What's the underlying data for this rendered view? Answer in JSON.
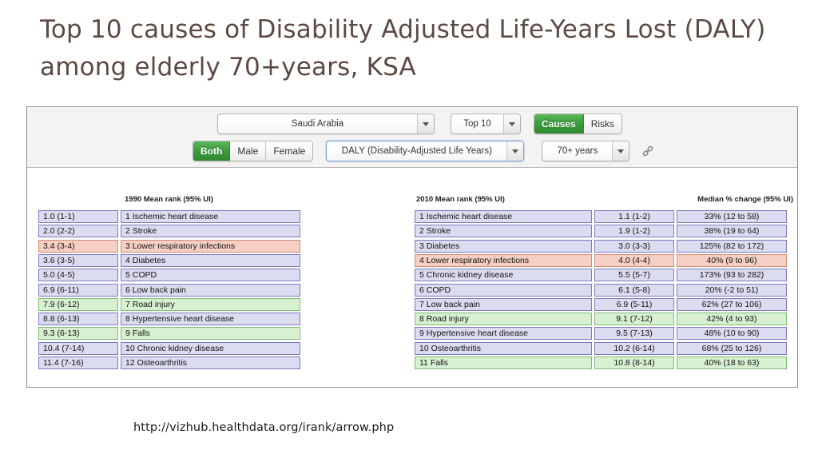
{
  "slide": {
    "title": "Top 10 causes of Disability Adjusted Life-Years Lost (DALY)\namong elderly 70+years, KSA",
    "caption": "http://vizhub.healthdata.org/irank/arrow.php"
  },
  "toolbar": {
    "country": "Saudi Arabia",
    "top_n": "Top 10",
    "causes_label": "Causes",
    "risks_label": "Risks",
    "sex_both": "Both",
    "sex_male": "Male",
    "sex_female": "Female",
    "metric": "DALY (Disability-Adjusted Life Years)",
    "age": "70+ years",
    "link_icon": "chain-link-icon"
  },
  "colors": {
    "accent_green": "#3d9d3d",
    "cell_default": "#dcdcf0",
    "cell_default_border": "#7a79c0",
    "cell_pink": "#f6cfc4",
    "cell_pink_border": "#d08a72",
    "cell_green": "#d7f0d2",
    "cell_green_border": "#7cbb74",
    "connector_navy": "#2a2a7a",
    "connector_red": "#c0392b",
    "connector_green": "#2e7d32",
    "title_brown": "#5c4a41"
  },
  "chart_data": {
    "type": "table",
    "title": "Top 10 causes of Disability Adjusted Life-Years Lost (DALY) among elderly 70+years, KSA",
    "headers": {
      "left": "1990 Mean rank (95% UI)",
      "right": "2010 Mean rank (95% UI)",
      "change": "Median % change (95% UI)"
    },
    "left_column": [
      {
        "rank": "1.0 (1-1)",
        "name": "1 Ischemic heart disease",
        "color": "default"
      },
      {
        "rank": "2.0 (2-2)",
        "name": "2 Stroke",
        "color": "default"
      },
      {
        "rank": "3.4 (3-4)",
        "name": "3 Lower respiratory infections",
        "color": "pink"
      },
      {
        "rank": "3.6 (3-5)",
        "name": "4 Diabetes",
        "color": "default"
      },
      {
        "rank": "5.0 (4-5)",
        "name": "5 COPD",
        "color": "default"
      },
      {
        "rank": "6.9 (6-11)",
        "name": "6 Low back pain",
        "color": "default"
      },
      {
        "rank": "7.9 (6-12)",
        "name": "7 Road injury",
        "color": "green"
      },
      {
        "rank": "8.8 (6-13)",
        "name": "8 Hypertensive heart disease",
        "color": "default"
      },
      {
        "rank": "9.3 (6-13)",
        "name": "9 Falls",
        "color": "green"
      },
      {
        "rank": "10.4 (7-14)",
        "name": "10 Chronic kidney disease",
        "color": "default"
      },
      {
        "rank": "11.4 (7-16)",
        "name": "12 Osteoarthritis",
        "color": "default"
      }
    ],
    "right_column": [
      {
        "name": "1 Ischemic heart disease",
        "rank": "1.1 (1-2)",
        "change": "33% (12 to 58)",
        "color": "default"
      },
      {
        "name": "2 Stroke",
        "rank": "1.9 (1-2)",
        "change": "38% (19 to 64)",
        "color": "default"
      },
      {
        "name": "3 Diabetes",
        "rank": "3.0 (3-3)",
        "change": "125% (82 to 172)",
        "color": "default"
      },
      {
        "name": "4 Lower respiratory infections",
        "rank": "4.0 (4-4)",
        "change": "40% (9 to 96)",
        "color": "pink"
      },
      {
        "name": "5 Chronic kidney disease",
        "rank": "5.5 (5-7)",
        "change": "173% (93 to 282)",
        "color": "default"
      },
      {
        "name": "6 COPD",
        "rank": "6.1 (5-8)",
        "change": "20% (-2 to 51)",
        "color": "default"
      },
      {
        "name": "7 Low back pain",
        "rank": "6.9 (5-11)",
        "change": "62% (27 to 106)",
        "color": "default"
      },
      {
        "name": "8 Road injury",
        "rank": "9.1 (7-12)",
        "change": "42% (4 to 93)",
        "color": "green"
      },
      {
        "name": "9 Hypertensive heart disease",
        "rank": "9.5 (7-13)",
        "change": "48% (10 to 90)",
        "color": "default"
      },
      {
        "name": "10 Osteoarthritis",
        "rank": "10.2 (6-14)",
        "change": "68% (25 to 126)",
        "color": "default"
      },
      {
        "name": "11 Falls",
        "rank": "10.8 (8-14)",
        "change": "40% (18 to 63)",
        "color": "green"
      }
    ],
    "connectors": [
      {
        "from": 0,
        "to": 0,
        "style": "solid",
        "color": "navy"
      },
      {
        "from": 1,
        "to": 1,
        "style": "solid",
        "color": "navy"
      },
      {
        "from": 2,
        "to": 3,
        "style": "dashed",
        "color": "red"
      },
      {
        "from": 3,
        "to": 2,
        "style": "solid",
        "color": "navy"
      },
      {
        "from": 4,
        "to": 5,
        "style": "dashed",
        "color": "navy"
      },
      {
        "from": 5,
        "to": 6,
        "style": "dashed",
        "color": "navy"
      },
      {
        "from": 6,
        "to": 7,
        "style": "dashed",
        "color": "green"
      },
      {
        "from": 7,
        "to": 8,
        "style": "dashed",
        "color": "navy"
      },
      {
        "from": 8,
        "to": 10,
        "style": "dashed",
        "color": "green"
      },
      {
        "from": 9,
        "to": 4,
        "style": "solid",
        "color": "navy"
      },
      {
        "from": 10,
        "to": 9,
        "style": "solid",
        "color": "navy"
      }
    ]
  }
}
